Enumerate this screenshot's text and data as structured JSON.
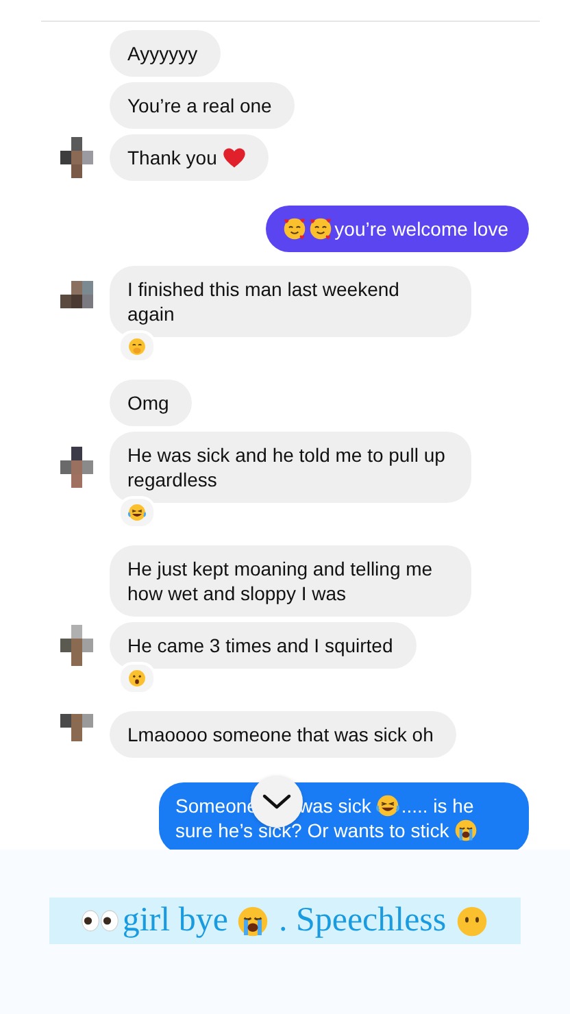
{
  "messages": [
    {
      "kind": "incoming",
      "avatar": false,
      "parts": [
        {
          "kind": "text",
          "text": "Ayyyyyy"
        }
      ]
    },
    {
      "kind": "incoming",
      "avatar": false,
      "parts": [
        {
          "kind": "text",
          "text": "You’re a real one"
        }
      ]
    },
    {
      "kind": "incoming",
      "avatar": true,
      "parts": [
        {
          "kind": "text",
          "text": "Thank you"
        },
        {
          "kind": "heart"
        }
      ]
    },
    {
      "kind": "outgoing",
      "color": "#5b45f0",
      "parts": [
        {
          "kind": "blush"
        },
        {
          "kind": "blush"
        },
        {
          "kind": "text",
          "text": "you’re welcome love"
        }
      ]
    },
    {
      "kind": "incoming",
      "avatar": true,
      "parts": [
        {
          "kind": "text",
          "text": "I finished this man last weekend again"
        }
      ],
      "reaction": {
        "kind": "giggle"
      }
    },
    {
      "kind": "incoming",
      "avatar": false,
      "parts": [
        {
          "kind": "text",
          "text": "Omg"
        }
      ]
    },
    {
      "kind": "incoming",
      "avatar": true,
      "parts": [
        {
          "kind": "text",
          "text": "He was sick and he told me to pull up regardless"
        }
      ],
      "reaction": {
        "kind": "laugh"
      }
    },
    {
      "kind": "incoming",
      "avatar": false,
      "parts": [
        {
          "kind": "text",
          "text": "He just kept moaning and telling me how wet and sloppy I was"
        }
      ]
    },
    {
      "kind": "incoming",
      "avatar": true,
      "parts": [
        {
          "kind": "text",
          "text": "He came 3 times and I squirted"
        }
      ],
      "reaction": {
        "kind": "hush"
      }
    },
    {
      "kind": "incoming",
      "avatar": true,
      "parts": [
        {
          "kind": "text",
          "text": "Lmaoooo someone that was sick oh"
        }
      ]
    },
    {
      "kind": "outgoing",
      "color": "#1a7cf5",
      "parts": [
        {
          "kind": "text",
          "text": "Someone"
        },
        {
          "kind": "scroll"
        },
        {
          "kind": "text",
          "text": "was sick"
        },
        {
          "kind": "laugh"
        },
        {
          "kind": "text",
          "text": "..... is he"
        },
        {
          "kind": "text",
          "text": "sure he’s sick? Or wants to stick"
        },
        {
          "kind": "sob"
        }
      ]
    }
  ],
  "caption": {
    "parts": [
      {
        "kind": "eyes"
      },
      {
        "kind": "text",
        "text": "girl bye"
      },
      {
        "kind": "sob"
      },
      {
        "kind": "text",
        "text": ". Speechless"
      },
      {
        "kind": "blank"
      }
    ]
  }
}
